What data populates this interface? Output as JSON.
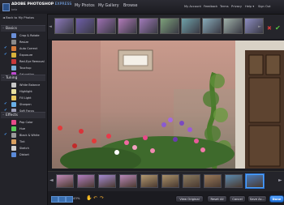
{
  "header": {
    "brand": "ADOBE PHOTOSHOP",
    "brand_suffix": "EXPRESS",
    "brand_sub": "beta",
    "nav": [
      "My Photos",
      "My Gallery",
      "Browse"
    ],
    "links": [
      "My Account",
      "Feedback",
      "Terms",
      "Privacy",
      "Help ▾",
      "Sign Out"
    ]
  },
  "sidebar": {
    "back_label": "◄ Back to My Photos",
    "sections": [
      {
        "title": "Basics",
        "items": [
          {
            "label": "Crop & Rotate",
            "checked": false,
            "icon_color": "#6a8fd8"
          },
          {
            "label": "Resize",
            "checked": false,
            "icon_color": "#8a8a8a"
          },
          {
            "label": "Auto Correct",
            "checked": true,
            "icon_color": "#d47a3a"
          },
          {
            "label": "Exposure",
            "checked": true,
            "icon_color": "#d8b23a"
          },
          {
            "label": "Red-Eye Removal",
            "checked": false,
            "icon_color": "#c83a3a"
          },
          {
            "label": "Touchup",
            "checked": false,
            "icon_color": "#7ab0d8"
          },
          {
            "label": "Saturation",
            "checked": false,
            "icon_color": "#c04ad0"
          }
        ]
      },
      {
        "title": "Tuning",
        "items": [
          {
            "label": "White Balance",
            "checked": false,
            "icon_color": "#c8c8c8"
          },
          {
            "label": "Highlight",
            "checked": false,
            "icon_color": "#e8e0a0"
          },
          {
            "label": "Fill Light",
            "checked": false,
            "icon_color": "#e8c860"
          },
          {
            "label": "Sharpen",
            "checked": true,
            "icon_color": "#6ab0e8"
          },
          {
            "label": "Soft Focus",
            "checked": true,
            "icon_color": "#a0a0b8"
          }
        ]
      },
      {
        "title": "Effects",
        "items": [
          {
            "label": "Pop Color",
            "checked": false,
            "icon_color": "#e84a8a"
          },
          {
            "label": "Hue",
            "checked": false,
            "icon_color": "#5ac85a"
          },
          {
            "label": "Black & White",
            "checked": true,
            "icon_color": "#9a9a9a"
          },
          {
            "label": "Tint",
            "checked": false,
            "icon_color": "#d8a060"
          },
          {
            "label": "Sketch",
            "checked": false,
            "icon_color": "#d0d0d0"
          },
          {
            "label": "Distort",
            "checked": false,
            "icon_color": "#5a8ad8"
          }
        ]
      }
    ]
  },
  "filmstrip_top": {
    "tints": [
      "#8b78b8",
      "#6e5ea8",
      "#9c6fb0",
      "#b07ab8",
      "#a07ab8",
      "#7da07a",
      "#6fa0a8",
      "#88aab8",
      "#9fb0a8",
      "#8c8cc0"
    ],
    "cancel_icon": "close-icon",
    "apply_icon": "checkmark-icon"
  },
  "filmstrip_bottom": {
    "tints": [
      "#c08ab8",
      "#b07ec0",
      "#a48ad0",
      "#b888b8",
      "#b29870",
      "#a8906a",
      "#8a7a60",
      "#9a7a5a",
      "#5a8ab0",
      "#4a7ab8"
    ],
    "selected_index": 10
  },
  "footer": {
    "zoom_label": "43%",
    "buttons": {
      "view_original": "View Original",
      "reset_all": "Reset All",
      "cancel": "Cancel",
      "save_as": "Save As...",
      "done": "Done"
    }
  }
}
